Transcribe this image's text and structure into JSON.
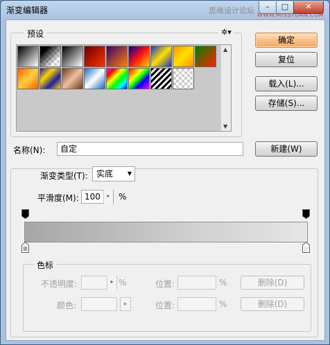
{
  "window": {
    "title": "渐变编辑器",
    "watermark": "思缘设计论坛",
    "watermark_url": "WWW.MISSYUAN.COM",
    "min_glyph": "–",
    "max_glyph": "□",
    "close_glyph": "✕"
  },
  "presets": {
    "label": "预设",
    "gear_glyph": "✲▾",
    "scroll_up": "▲",
    "scroll_down": "▼",
    "swatches": [
      "linear-gradient(135deg,#000,#fff)",
      "checker-black",
      "linear-gradient(135deg,#000,#fff)",
      "linear-gradient(135deg,#6a0000,#ff3000)",
      "linear-gradient(135deg,#3a0070,#ff8000)",
      "linear-gradient(135deg,#0000a0,#ff1010,#ffd000)",
      "linear-gradient(135deg,#2030c0,#ffe000,#2030c0)",
      "linear-gradient(135deg,#ff9000,#ffe000,#ff9000)",
      "linear-gradient(135deg,#008000,#ff2000)",
      "linear-gradient(135deg,#ff6000,#ffd040,#ff6000)",
      "linear-gradient(135deg,#2020a0,#ffd000,#2020a0,#ffd000)",
      "linear-gradient(135deg,#6a3a20,#f0c0a0,#6a3a20)",
      "linear-gradient(135deg,#1a6ac0,#fff,#1a6ac0)",
      "linear-gradient(135deg,#ff00ff,#ff0000,#ffff00,#00ff00,#00ffff,#0000ff)",
      "linear-gradient(135deg,#ff0000,#ff8000,#ffff00,#00ff00,#0000ff,#8000ff,#ff00ff)",
      "repeating-linear-gradient(135deg,#000 0 3px,#fff 3px 6px)",
      "checker-gray"
    ]
  },
  "buttons": {
    "ok": "确定",
    "reset": "复位",
    "load": "载入(L)...",
    "save": "存储(S)...",
    "new": "新建(W)"
  },
  "name": {
    "label": "名称(N):",
    "value": "自定"
  },
  "gradient": {
    "type_label": "渐变类型(T):",
    "type_value": "实底",
    "type_arrow": "▼",
    "smooth_label": "平滑度(M):",
    "smooth_value": "100",
    "smooth_unit": "%",
    "spin_glyph": "▸"
  },
  "color_stops": {
    "label": "色标",
    "opacity_label": "不透明度:",
    "opacity_unit": "%",
    "opacity_pos_label": "位置:",
    "opacity_pos_unit": "%",
    "opacity_delete": "删除(D)",
    "color_label": "颜色:",
    "color_spin": "▸",
    "color_pos_label": "位置:",
    "color_pos_unit": "%",
    "color_delete": "删除(D)"
  }
}
